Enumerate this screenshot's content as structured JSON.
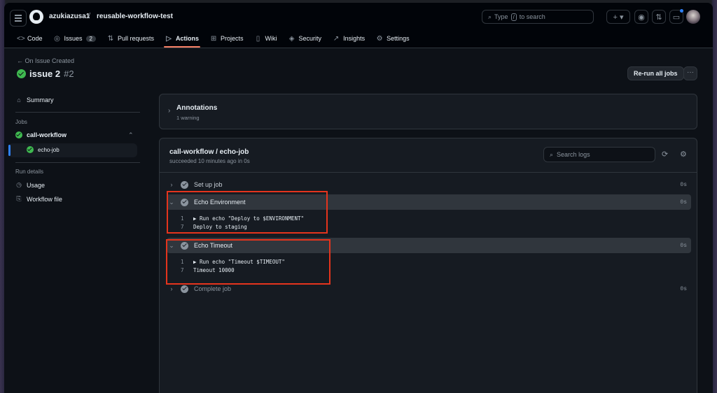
{
  "header": {
    "owner": "azukiazusa1",
    "separator": "/",
    "repo": "reusable-workflow-test",
    "search_prefix": "Type",
    "search_key": "/",
    "search_suffix": "to search"
  },
  "tabs": [
    {
      "label": "Code",
      "icon": "code-icon"
    },
    {
      "label": "Issues",
      "icon": "issue-icon",
      "count": "2"
    },
    {
      "label": "Pull requests",
      "icon": "pull-request-icon"
    },
    {
      "label": "Actions",
      "icon": "play-icon",
      "active": true
    },
    {
      "label": "Projects",
      "icon": "table-icon"
    },
    {
      "label": "Wiki",
      "icon": "book-icon"
    },
    {
      "label": "Security",
      "icon": "shield-icon"
    },
    {
      "label": "Insights",
      "icon": "graph-icon"
    },
    {
      "label": "Settings",
      "icon": "gear-icon"
    }
  ],
  "run": {
    "back_label": "On Issue Created",
    "title": "issue 2",
    "number": "#2",
    "rerun_label": "Re-run all jobs"
  },
  "sidebar": {
    "summary": "Summary",
    "jobs_heading": "Jobs",
    "job_group": "call-workflow",
    "job_item": "echo-job",
    "run_details_heading": "Run details",
    "usage": "Usage",
    "workflow_file": "Workflow file"
  },
  "annotations": {
    "title": "Annotations",
    "subtitle": "1 warning"
  },
  "job": {
    "title": "call-workflow / echo-job",
    "status": "succeeded 10 minutes ago in 0s",
    "search_placeholder": "Search logs",
    "steps": [
      {
        "name": "Set up job",
        "duration": "0s"
      },
      {
        "name": "Echo Environment",
        "duration": "0s",
        "log": [
          {
            "line": "1",
            "text": "▶ Run echo \"Deploy to $ENVIRONMENT\""
          },
          {
            "line": "7",
            "text": "Deploy to staging"
          }
        ]
      },
      {
        "name": "Echo Timeout",
        "duration": "0s",
        "log": [
          {
            "line": "1",
            "text": "▶ Run echo \"Timeout $TIMEOUT\""
          },
          {
            "line": "7",
            "text": "Timeout 10000"
          }
        ]
      },
      {
        "name": "Complete job",
        "duration": "0s"
      }
    ]
  },
  "colors": {
    "background": "#0d1117",
    "success": "#3fb950",
    "active_tab_underline": "#f78166",
    "highlight_box": "#e5341d"
  }
}
